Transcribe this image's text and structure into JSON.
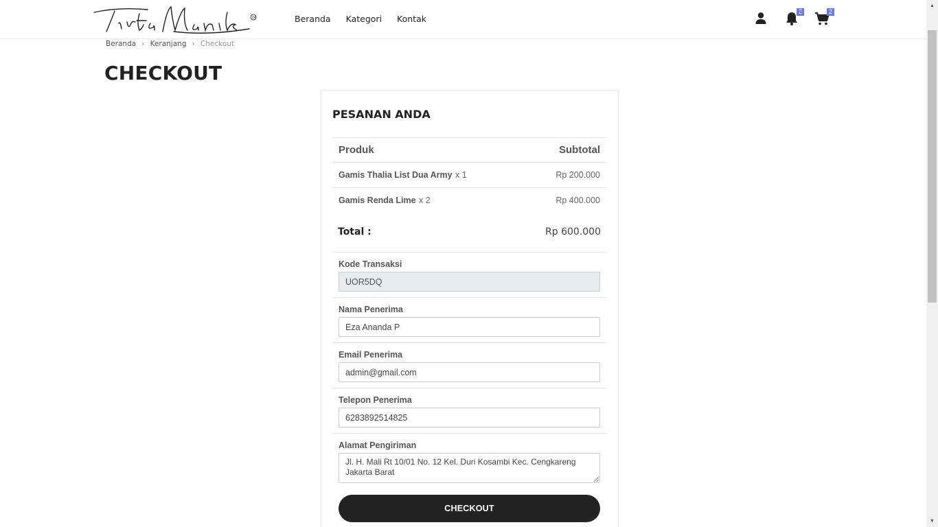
{
  "header": {
    "logo_text": "Tirta Manik",
    "nav": [
      {
        "label": "Beranda"
      },
      {
        "label": "Kategori"
      },
      {
        "label": "Kontak"
      }
    ],
    "notification_count": "2",
    "cart_count": "2"
  },
  "breadcrumb": {
    "items": [
      "Beranda",
      "Keranjang"
    ],
    "current": "Checkout"
  },
  "page": {
    "title": "CHECKOUT"
  },
  "order": {
    "title": "PESANAN ANDA",
    "columns": {
      "product": "Produk",
      "subtotal": "Subtotal"
    },
    "items": [
      {
        "name": "Gamis Thalia List Dua Army",
        "qty": "x 1",
        "price": "Rp 200.000"
      },
      {
        "name": "Gamis Renda Lime",
        "qty": "x 2",
        "price": "Rp 400.000"
      }
    ],
    "total_label": "Total :",
    "total_value": "Rp 600.000"
  },
  "form": {
    "kode_label": "Kode Transaksi",
    "kode_value": "UOR5DQ",
    "nama_label": "Nama Penerima",
    "nama_value": "Eza Ananda P",
    "email_label": "Email Penerima",
    "email_value": "admin@gmail.com",
    "telepon_label": "Telepon Penerima",
    "telepon_value": "6283892514825",
    "alamat_label": "Alamat Pengiriman",
    "alamat_value": "Jl. H. Mali Rt 10/01 No. 12 Kel. Duri Kosambi Kec. Cengkareng Jakarta Barat",
    "submit_label": "CHECKOUT"
  },
  "colors": {
    "badge": "#6c7ae0",
    "button": "#222222",
    "readonly_bg": "#e9ecef"
  }
}
